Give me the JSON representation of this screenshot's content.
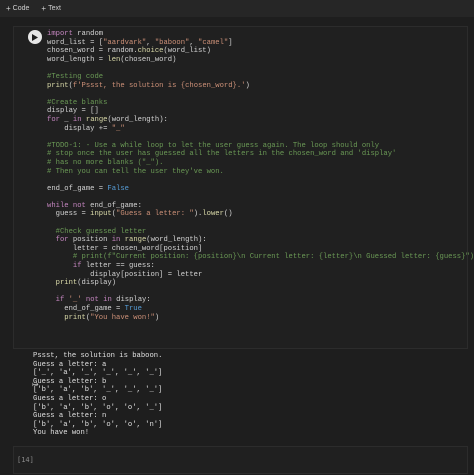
{
  "toolbar": {
    "code_label": "Code",
    "text_label": "Text"
  },
  "code_lines": [
    "import random",
    "word_list = [\"aardvark\", \"baboon\", \"camel\"]",
    "chosen_word = random.choice(word_list)",
    "word_length = len(chosen_word)",
    "",
    "#Testing code",
    "print(f'Pssst, the solution is {chosen_word}.')",
    "",
    "#Create blanks",
    "display = []",
    "for _ in range(word_length):",
    "    display += \"_\"",
    "",
    "#TODO-1: - Use a while loop to let the user guess again. The loop should only",
    "# stop once the user has guessed all the letters in the chosen_word and 'display'",
    "# has no more blanks (\"_\").",
    "# Then you can tell the user they've won.",
    "",
    "end_of_game = False",
    "",
    "while not end_of_game:",
    "  guess = input(\"Guess a letter: \").lower()",
    "",
    "  #Check guessed letter",
    "  for position in range(word_length):",
    "      letter = chosen_word[position]",
    "      # print(f\"Current position: {position}\\n Current letter: {letter}\\n Guessed letter: {guess}\")",
    "      if letter == guess:",
    "          display[position] = letter",
    "  print(display)",
    "",
    "  if '_' not in display:",
    "    end_of_game = True",
    "    print(\"You have won!\")"
  ],
  "output_lines": [
    "Pssst, the solution is baboon.",
    "Guess a letter: a",
    "['_', 'a', '_', '_', '_', '_']",
    "Guess a letter: b",
    "['b', 'a', 'b', '_', '_', '_']",
    "Guess a letter: o",
    "['b', 'a', 'b', 'o', 'o', '_']",
    "Guess a letter: n",
    "['b', 'a', 'b', 'o', 'o', 'n']",
    "You have won!"
  ],
  "next_cell": {
    "execution_count": "[14]"
  },
  "colors": {
    "background": "#1e1e1e",
    "keyword": "#569cd6",
    "string": "#ce9178",
    "comment": "#6a9955"
  }
}
